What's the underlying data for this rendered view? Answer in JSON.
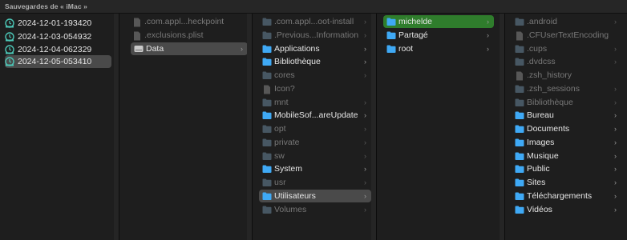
{
  "title": "Sauvegardes de « iMac »",
  "colors": {
    "folder": "#3fa9f5",
    "folder_dim": "#7a9db7",
    "doc": "#9d9d9d",
    "selected_gray": "#4a4a4a",
    "selected_green": "#2f7d2c"
  },
  "col1": [
    "2024-12-01-193420",
    "2024-12-03-054932",
    "2024-12-04-062329",
    "2024-12-05-053410"
  ],
  "col2": [
    ".com.appl...heckpoint",
    ".exclusions.plist",
    "Data"
  ],
  "col3": [
    ".com.appl...oot-install",
    ".Previous...Information",
    "Applications",
    "Bibliothèque",
    "cores",
    "Icon?",
    "mnt",
    "MobileSof...areUpdate",
    "opt",
    "private",
    "sw",
    "System",
    "usr",
    "Utilisateurs",
    "Volumes"
  ],
  "col4": [
    "michelde",
    "Partagé",
    "root"
  ],
  "col5": [
    ".android",
    ".CFUserTextEncoding",
    ".cups",
    ".dvdcss",
    ".zsh_history",
    ".zsh_sessions",
    "Bibliothèque",
    "Bureau",
    "Documents",
    "Images",
    "Musique",
    "Public",
    "Sites",
    "Téléchargements",
    "Vidéos"
  ],
  "chevron": "›"
}
